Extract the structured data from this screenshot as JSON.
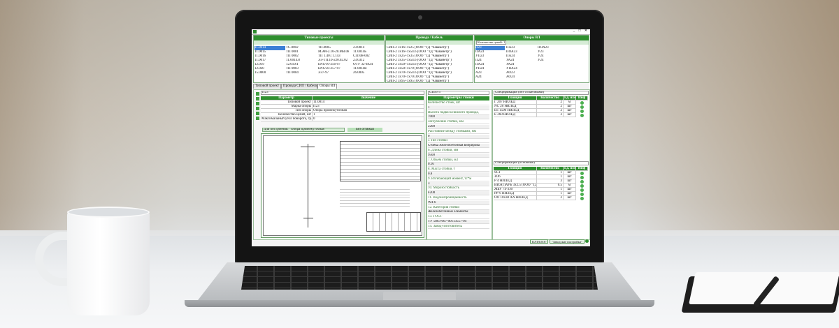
{
  "app": {
    "title": "",
    "window_buttons": "_ □ ✕"
  },
  "panels": {
    "types": {
      "header": "Типовые проекты",
      "columns": [
        [
          "11.0014",
          "11.0015",
          "11.0016",
          "11.0017",
          "12.019",
          "12.020",
          "15.0000"
        ],
        [
          "ТС.0002",
          "ТП 0001",
          "ТП 0002",
          "11.0014.8",
          "12.019Л",
          "ТП 0003",
          "ТП 0004"
        ],
        [
          "ТП.0005",
          "МЭМ-2.10-20.МВ.08",
          "ТП 1.407.1.143",
          "ЭЗ-ТП.10-220.02.02",
          "ENS/10-256-97",
          "ENS/50-257-97",
          "ЭЗ7-97"
        ],
        [
          "23.0014",
          "11.0014Б",
          "СП108-002",
          "23.0312",
          "ОТУ 32-4924",
          "11.0014В",
          "26.0005"
        ]
      ],
      "selected": "11.0014"
    },
    "wires": {
      "header": "Провода / Кабель",
      "items": [
        "СИП-2 3х16+1х25 (ООО \"ТД \"Чаваметр\")",
        "СИП-2 3х16+1х54.6 (ООО \"ТД \"Чаваметр\")",
        "СИП-2 3х25+1х35 (ООО \"ТД \"Чаваметр\")",
        "СИП-2 3х35+1х54.6 (ООО \"ТД \"Чаваметр\")",
        "СИП-2 3х50+1х54.6 (ООО \"ТД \"Чаваметр\")",
        "СИП-2 3х50+1х70 (ООО \"ТД \"Чаваметр\")",
        "СИП-2 3х70+1х54.6 (ООО \"ТД \"Чаваметр\")",
        "СИП-2 3х70+1х70 (ООО \"ТД \"Чаваметр\")",
        "СИП-2 3х95+1х95 (ООО \"ТД \"Чаваметр\")"
      ]
    },
    "supports": {
      "header": "Опоры ВЛ",
      "combo_label": "Количество цепей: 1",
      "columns": [
        [
          "П23",
          "ПА23",
          "УП23",
          "П24",
          "ПА24",
          "УП24",
          "А23",
          "А24"
        ],
        [
          "ПА23",
          "ПОА23",
          "ПА24",
          "УА24",
          "УА24",
          "УПА24",
          "АО23",
          "АО24"
        ],
        [
          "ПОА23",
          "У23",
          "У24",
          "У24"
        ]
      ],
      "selected": "П23"
    }
  },
  "tabs": [
    "Типовой проект",
    "Провода СИП / Кабель",
    "Опоры ВЛ"
  ],
  "params": {
    "combo": "П23",
    "headers": [
      "Параметр",
      "Значение"
    ],
    "rows": [
      [
        "Типовой проект",
        "11.0014"
      ],
      [
        "Марка опоры",
        "П23"
      ],
      [
        "Тип опоры",
        "Опора промежуточная"
      ],
      [
        "Количество цепей, шт",
        "1"
      ],
      [
        "Максимальный угол поворота, гр.",
        "0"
      ]
    ],
    "build_label": "Для построения: \"Опора промежуточная\"",
    "no_guy": "Без оттяжки"
  },
  "stand": {
    "combo": "СВ95-3",
    "header": "Параметры стойки",
    "rows": [
      "Количество стоек, шт",
      "1",
      "Высота подвеса нижнего провода,",
      "7000",
      "Заглубление стойки, мм",
      "2200",
      "Расстояние между стойками, мм",
      "0",
      "5 Тип стойки",
      "Стойка железобетонная вибрирова",
      "6. Длина стойки, мм",
      "9500",
      "7. Объем стойки, м3",
      "0.16",
      "8. Масса стойки, т",
      "0.8",
      "9. Изгибающий момент, тс*м",
      "3",
      "10. Морозостойкость",
      "F200",
      "11. Водонепроницаемость",
      "W4-6",
      "12. Категория стойки",
      "Железобетонные элементы",
      "13. ГОСТ",
      "ТУ 5863-007-00113557-94",
      "14. Завод-изготовитель"
    ]
  },
  "spec1": {
    "title": "Спецификация (без отпаечными)",
    "headers": [
      "Позиция",
      "Количество",
      "Ед. изм.",
      "Инф"
    ],
    "rows": [
      [
        "Г 207 НИЛЕД",
        "2",
        "м"
      ],
      [
        "NC 20 НИЛЕД",
        "2",
        "шт"
      ],
      [
        "ES 1500 НИЛЕД",
        "2",
        "шт"
      ],
      [
        "Е 260 НИЛЕД",
        "3",
        "шт"
      ]
    ]
  },
  "spec2": {
    "title": "Спецификация (основные)",
    "headers": [
      "Позиция",
      "Количество",
      "Ед. изм.",
      "Инф"
    ],
    "rows": [
      [
        "SC1",
        "1",
        "шт"
      ],
      [
        "ЗО6",
        "1",
        "шт"
      ],
      [
        "Р 4 НИЛЕД",
        "3",
        "шт"
      ],
      [
        "ВИЭ(с)АУБ 3х2.5 (ООО \"ТД \"Ч",
        "0.5",
        "м"
      ],
      [
        "ЖБУ 74-330",
        "1",
        "шт"
      ],
      [
        "РР-6 НИЛЕД",
        "1",
        "шт"
      ],
      [
        "ОО 10х38 АА НИЛЕД",
        "2",
        "шт"
      ]
    ]
  },
  "footer": {
    "catalog": "КАТАЛОГ",
    "factory": "\"Заводские настройки\""
  }
}
